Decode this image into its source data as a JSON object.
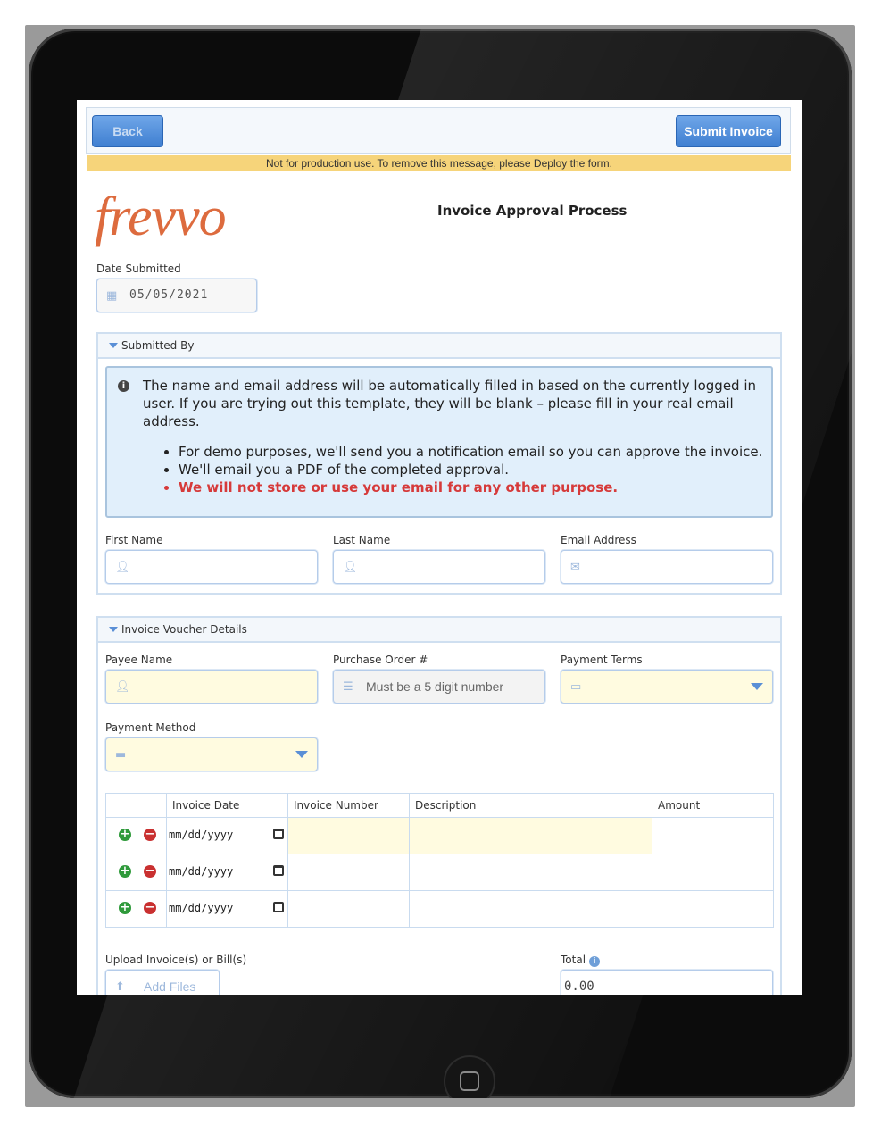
{
  "toolbar": {
    "back_label": "Back",
    "submit_label": "Submit Invoice"
  },
  "banner": "Not for production use. To remove this message, please Deploy the form.",
  "logo": "frevvo",
  "form_title": "Invoice Approval Process",
  "date_submitted": {
    "label": "Date Submitted",
    "value": "05/05/2021"
  },
  "submitted_by": {
    "heading": "Submitted By",
    "info_text": "The name and email address will be automatically filled in based on the currently logged in user. If you are trying out this template, they will be blank – please fill in your real email address.",
    "bullets": [
      "For demo purposes, we'll send you a notification email so you can approve the invoice.",
      "We'll email you a PDF of the completed approval.",
      "We will not store or use your email for any other purpose."
    ],
    "first_name_label": "First Name",
    "last_name_label": "Last Name",
    "email_label": "Email Address"
  },
  "voucher": {
    "heading": "Invoice Voucher Details",
    "payee_label": "Payee Name",
    "po_label": "Purchase Order #",
    "po_placeholder": "Must be a 5 digit number",
    "terms_label": "Payment Terms",
    "method_label": "Payment Method",
    "columns": [
      "Invoice Date",
      "Invoice Number",
      "Description",
      "Amount"
    ],
    "date_placeholder": "mm/dd/yyyy",
    "row_count": 3
  },
  "upload_label": "Upload Invoice(s) or Bill(s)",
  "add_files_label": "Add Files",
  "total_label": "Total",
  "total_value": "0.00",
  "colors": {
    "accent": "#3f7fd1",
    "logo": "#dd6b3e",
    "warning": "#d63a3a",
    "banner": "#f6d47a",
    "required_field": "#fffbe0"
  },
  "icons": [
    "calendar-icon",
    "info-icon",
    "user-icon",
    "envelope-icon",
    "list-icon",
    "money-icon",
    "credit-card-icon",
    "plus-icon",
    "minus-icon",
    "upload-icon"
  ]
}
